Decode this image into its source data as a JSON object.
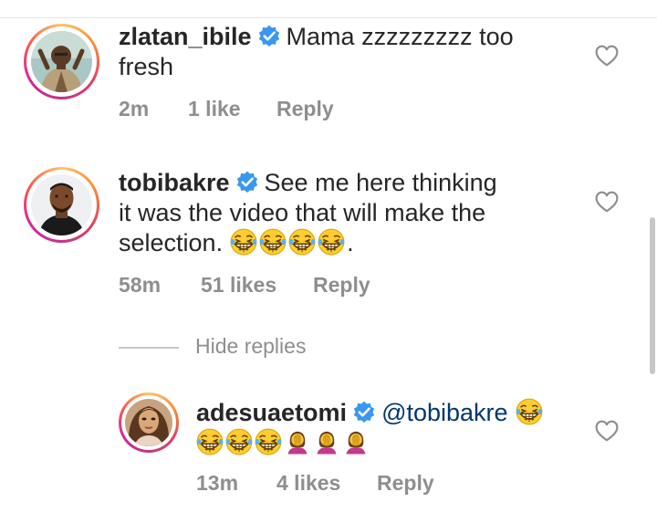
{
  "comments": [
    {
      "username": "zlatan_ibile",
      "text": "Mama zzzzzzzzz too fresh",
      "text_line1": "Mama zzzzzzzzz too",
      "text_line2": "fresh",
      "time": "2m",
      "likes": "1 like",
      "reply": "Reply",
      "verified": true
    },
    {
      "username": "tobibakre",
      "text_line1": "See me here thinking",
      "text_line2": "it was the video that will make the",
      "text_line3": "selection.",
      "emojis": [
        "grinning-squinting-face",
        "grinning-squinting-face",
        "grinning-squinting-face",
        "grinning-squinting-face"
      ],
      "trailing": ".",
      "time": "58m",
      "likes": "51 likes",
      "reply": "Reply",
      "verified": true
    }
  ],
  "hide_replies": "Hide replies",
  "reply_comment": {
    "username": "adesuaetomi",
    "mention": "@tobibakre",
    "emojis": [
      "grinning-squinting-face",
      "grinning-squinting-face",
      "grinning-squinting-face",
      "grinning-squinting-face",
      "woman-facepalming",
      "woman-facepalming",
      "woman-facepalming"
    ],
    "time": "13m",
    "likes": "4 likes",
    "reply": "Reply",
    "verified": true
  },
  "colors": {
    "verified_blue": "#3897f0",
    "text": "#262626",
    "meta_gray": "#8e8e8e",
    "mention": "#00376b"
  }
}
